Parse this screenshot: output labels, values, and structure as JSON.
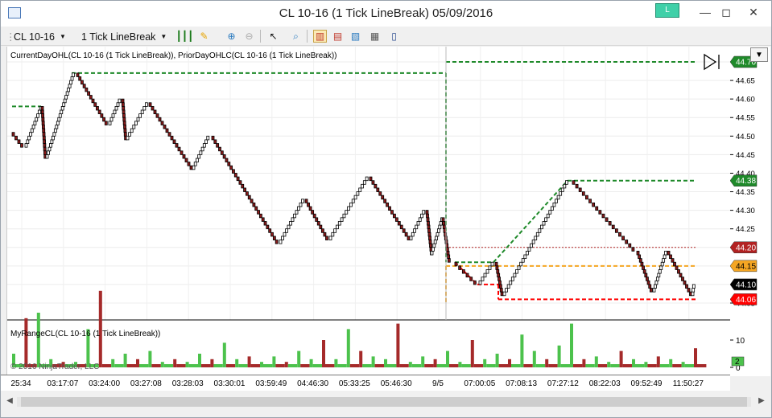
{
  "window": {
    "title": "CL 10-16 (1 Tick LineBreak)  05/09/2016",
    "link_label": "L"
  },
  "toolbar": {
    "instrument": "CL 10-16",
    "bar_type": "1 Tick LineBreak"
  },
  "panels": {
    "price_indicator_label": "CurrentDayOHL(CL 10-16 (1 Tick LineBreak)), PriorDayOHLC(CL 10-16 (1 Tick LineBreak))",
    "range_indicator_label": "MyRangeCL(CL 10-16 (1 Tick LineBreak))",
    "copyright": "© 2016 NinjaTrader, LLC"
  },
  "price_axis": {
    "ticks": [
      "44.70",
      "44.65",
      "44.60",
      "44.55",
      "44.50",
      "44.45",
      "44.40",
      "44.35",
      "44.30",
      "44.25",
      "44.20",
      "44.15",
      "44.10",
      "44.05"
    ],
    "markers": [
      {
        "value": "44.70",
        "color": "#1f8a2a",
        "text_color": "#ffffff"
      },
      {
        "value": "44.38",
        "color": "#1f8a2a",
        "text_color": "#ffffff"
      },
      {
        "value": "44.20",
        "color": "#b22222",
        "text_color": "#ffffff"
      },
      {
        "value": "44.15",
        "color": "#f5a623",
        "text_color": "#000000"
      },
      {
        "value": "44.10",
        "color": "#000000",
        "text_color": "#ffffff"
      },
      {
        "value": "44.06",
        "color": "#ff0000",
        "text_color": "#ffffff"
      }
    ]
  },
  "range_axis": {
    "ticks": [
      "10",
      "0"
    ],
    "marker": "2"
  },
  "time_axis": {
    "labels": [
      "25:34",
      "03:17:07",
      "03:24:00",
      "03:27:08",
      "03:28:03",
      "03:30:01",
      "03:59:49",
      "04:46:30",
      "05:33:25",
      "05:46:30",
      "9/5",
      "07:00:05",
      "07:08:13",
      "07:27:12",
      "08:22:03",
      "09:52:49",
      "11:50:27"
    ]
  },
  "colors": {
    "up_box": "#ffffff",
    "down_box": "#8b1a1a",
    "current_day_level": "#1f8a2a",
    "prior_day_high": "#b22222",
    "prior_day_close": "#f5a623",
    "prior_day_low": "#ff0000",
    "range_up": "#4cc24c",
    "range_down": "#a52a2a"
  }
}
